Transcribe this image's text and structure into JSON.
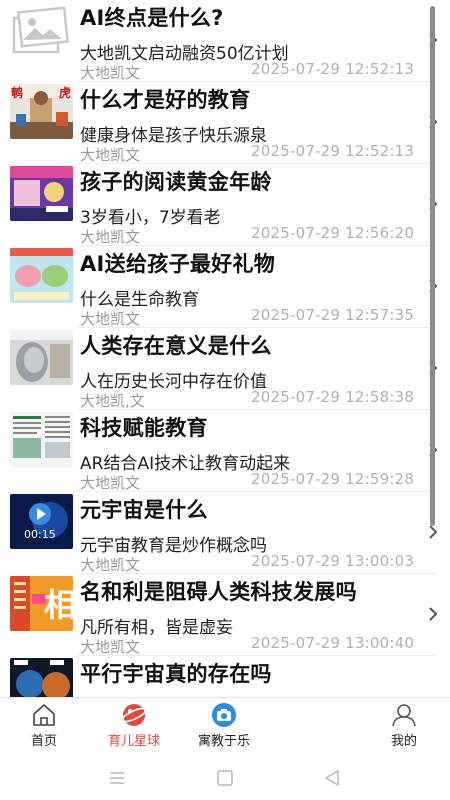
{
  "feed": {
    "items": [
      {
        "title": "AI终点是什么?",
        "subtitle": "大地凯文启动融资50亿计划",
        "author": "大地凯文",
        "time": "2025-07-29 12:52:13",
        "thumb": "placeholder-image"
      },
      {
        "title": "什么才是好的教育",
        "subtitle": "健康身体是孩子快乐源泉",
        "author": "大地凯文",
        "time": "2025-07-29 12:52:13",
        "thumb": "classroom-photo",
        "thumb_text_left": "鹌",
        "thumb_text_right": "虎"
      },
      {
        "title": "孩子的阅读黄金年龄",
        "subtitle": "3岁看小，7岁看老",
        "author": "大地凯文",
        "time": "2025-07-29 12:56:20",
        "thumb": "reading-photo"
      },
      {
        "title": "AI送给孩子最好礼物",
        "subtitle": "什么是生命教育",
        "author": "大地凯文",
        "time": "2025-07-29 12:57:35",
        "thumb": "brain-poster"
      },
      {
        "title": "人类存在意义是什么",
        "subtitle": "人在历史长河中存在价值",
        "author": "大地凯,文",
        "time": "2025-07-29 12:58:38",
        "thumb": "robot-face"
      },
      {
        "title": "科技赋能教育",
        "subtitle": "AR结合AI技术让教育动起来",
        "author": "大地凯文",
        "time": "2025-07-29 12:59:28",
        "thumb": "document-page"
      },
      {
        "title": "元宇宙是什么",
        "subtitle": "元宇宙教育是炒作概念吗",
        "author": "大地凯文",
        "time": "2025-07-29 13:00:03",
        "thumb": "video-thumb",
        "thumb_text": "00:15"
      },
      {
        "title": "名和利是阻碍人类科技发展吗",
        "subtitle": "凡所有相，皆是虚妄",
        "author": "大地凯文",
        "time": "2025-07-29 13:00:40",
        "thumb": "xiang-poster",
        "thumb_text": "相"
      },
      {
        "title": "平行宇宙真的存在吗",
        "subtitle": "",
        "author": "",
        "time": "",
        "thumb": "planet-image"
      }
    ]
  },
  "tabbar": {
    "tabs": [
      {
        "label": "首页",
        "icon": "home-icon",
        "active": false
      },
      {
        "label": "育儿星球",
        "icon": "planet-icon",
        "active": true
      },
      {
        "label": "寓教于乐",
        "icon": "camera-icon",
        "active": false
      },
      {
        "label": "我的",
        "icon": "user-icon",
        "active": false
      }
    ]
  },
  "colors": {
    "accent": "#e24a3d",
    "camera_blue": "#2a8de0",
    "secondary_text": "#9a9a9a"
  }
}
